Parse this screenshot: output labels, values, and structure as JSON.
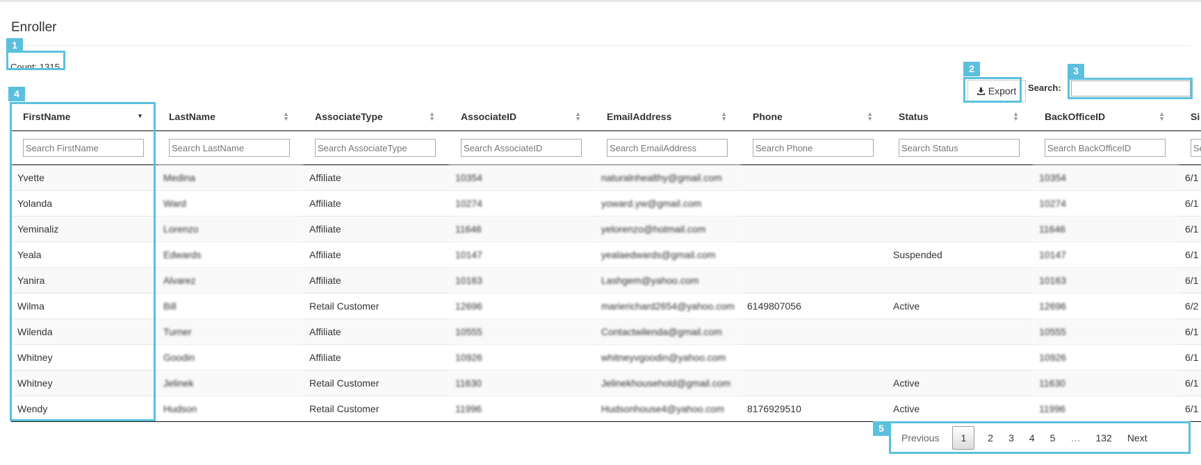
{
  "header": {
    "title": "Enroller",
    "count_label": "Count: 1315"
  },
  "toolbar": {
    "export_label": "Export",
    "search_label": "Search:",
    "search_value": ""
  },
  "table": {
    "columns": [
      {
        "label": "FirstName",
        "placeholder": "Search FirstName",
        "sort": "desc"
      },
      {
        "label": "LastName",
        "placeholder": "Search LastName",
        "sort": "both"
      },
      {
        "label": "AssociateType",
        "placeholder": "Search AssociateType",
        "sort": "both"
      },
      {
        "label": "AssociateID",
        "placeholder": "Search AssociateID",
        "sort": "both"
      },
      {
        "label": "EmailAddress",
        "placeholder": "Search EmailAddress",
        "sort": "both"
      },
      {
        "label": "Phone",
        "placeholder": "Search Phone",
        "sort": "both"
      },
      {
        "label": "Status",
        "placeholder": "Search Status",
        "sort": "both"
      },
      {
        "label": "BackOfficeID",
        "placeholder": "Search BackOfficeID",
        "sort": "both"
      },
      {
        "label": "Si",
        "placeholder": "Se",
        "sort": "both"
      }
    ],
    "rows": [
      [
        "Yvette",
        "Medina",
        "Affiliate",
        "10354",
        "naturalnhealthy@gmail.com",
        "",
        "",
        "10354",
        "6/1"
      ],
      [
        "Yolanda",
        "Ward",
        "Affiliate",
        "10274",
        "yoward.yw@gmail.com",
        "",
        "",
        "10274",
        "6/1"
      ],
      [
        "Yeminaliz",
        "Lorenzo",
        "Affiliate",
        "11646",
        "yelorenzo@hotmail.com",
        "",
        "",
        "11646",
        "6/1"
      ],
      [
        "Yeala",
        "Edwards",
        "Affiliate",
        "10147",
        "yealaedwards@gmail.com",
        "",
        "Suspended",
        "10147",
        "6/1"
      ],
      [
        "Yanira",
        "Alvarez",
        "Affiliate",
        "10163",
        "Lashgem@yahoo.com",
        "",
        "",
        "10163",
        "6/1"
      ],
      [
        "Wilma",
        "Bill",
        "Retail Customer",
        "12696",
        "marierichard2654@yahoo.com",
        "6149807056",
        "Active",
        "12696",
        "6/2"
      ],
      [
        "Wilenda",
        "Turner",
        "Affiliate",
        "10555",
        "Contactwilenda@gmail.com",
        "",
        "",
        "10555",
        "6/1"
      ],
      [
        "Whitney",
        "Goodin",
        "Affiliate",
        "10926",
        "whitneyvgoodin@yahoo.com",
        "",
        "",
        "10926",
        "6/1"
      ],
      [
        "Whitney",
        "Jelinek",
        "Retail Customer",
        "11630",
        "Jelinekhousehold@gmail.com",
        "",
        "Active",
        "11630",
        "6/1"
      ],
      [
        "Wendy",
        "Hudson",
        "Retail Customer",
        "11996",
        "Hudsonhouse4@yahoo.com",
        "8176929510",
        "Active",
        "11996",
        "6/1"
      ]
    ],
    "blurred_columns": [
      1,
      3,
      4,
      7
    ]
  },
  "pagination": {
    "previous": "Previous",
    "pages": [
      "1",
      "2",
      "3",
      "4",
      "5"
    ],
    "ellipsis": "…",
    "last": "132",
    "next": "Next",
    "current": "1"
  },
  "annotations": {
    "badges": [
      "1",
      "2",
      "3",
      "4",
      "5"
    ],
    "color": "#5bc0de"
  },
  "icons": {
    "export": "download-icon",
    "sort": "sort-arrows-icon"
  }
}
